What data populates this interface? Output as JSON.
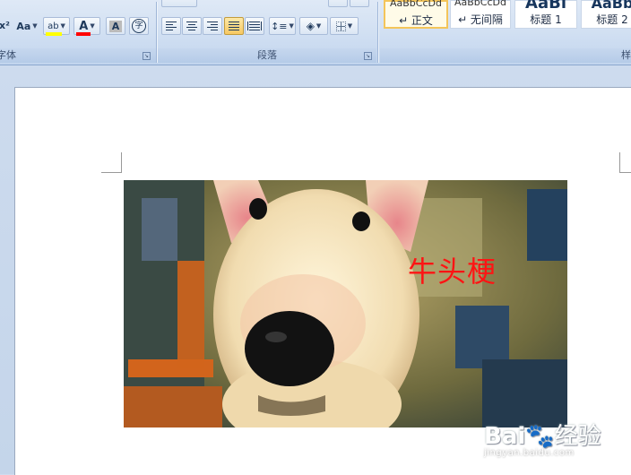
{
  "ribbon": {
    "font_group": {
      "label": "字体",
      "superscript_glyph": "x²",
      "change_case": "Aa",
      "highlight_glyph": "ab",
      "font_color_glyph": "A",
      "char_shading_glyph": "A",
      "enclose_glyph": "字"
    },
    "paragraph_group": {
      "label": "段落"
    },
    "styles_group": {
      "label": "样",
      "items": [
        {
          "preview": "AaBbCcDd",
          "name": "↵ 正文",
          "selected": true
        },
        {
          "preview": "AaBbCcDd",
          "name": "↵ 无间隔",
          "selected": false
        },
        {
          "preview": "AaBl",
          "name": "标题 1",
          "selected": false
        },
        {
          "preview": "AaBb",
          "name": "标题 2",
          "selected": false
        }
      ]
    },
    "colors": {
      "highlight": "#ffff00",
      "font_color": "#ff0000"
    }
  },
  "document": {
    "image_caption": "牛头梗",
    "caption_color": "#ff1414"
  },
  "watermark": {
    "logo_left": "Bai",
    "logo_right": "经验",
    "url": "jingyan.baidu.com"
  }
}
